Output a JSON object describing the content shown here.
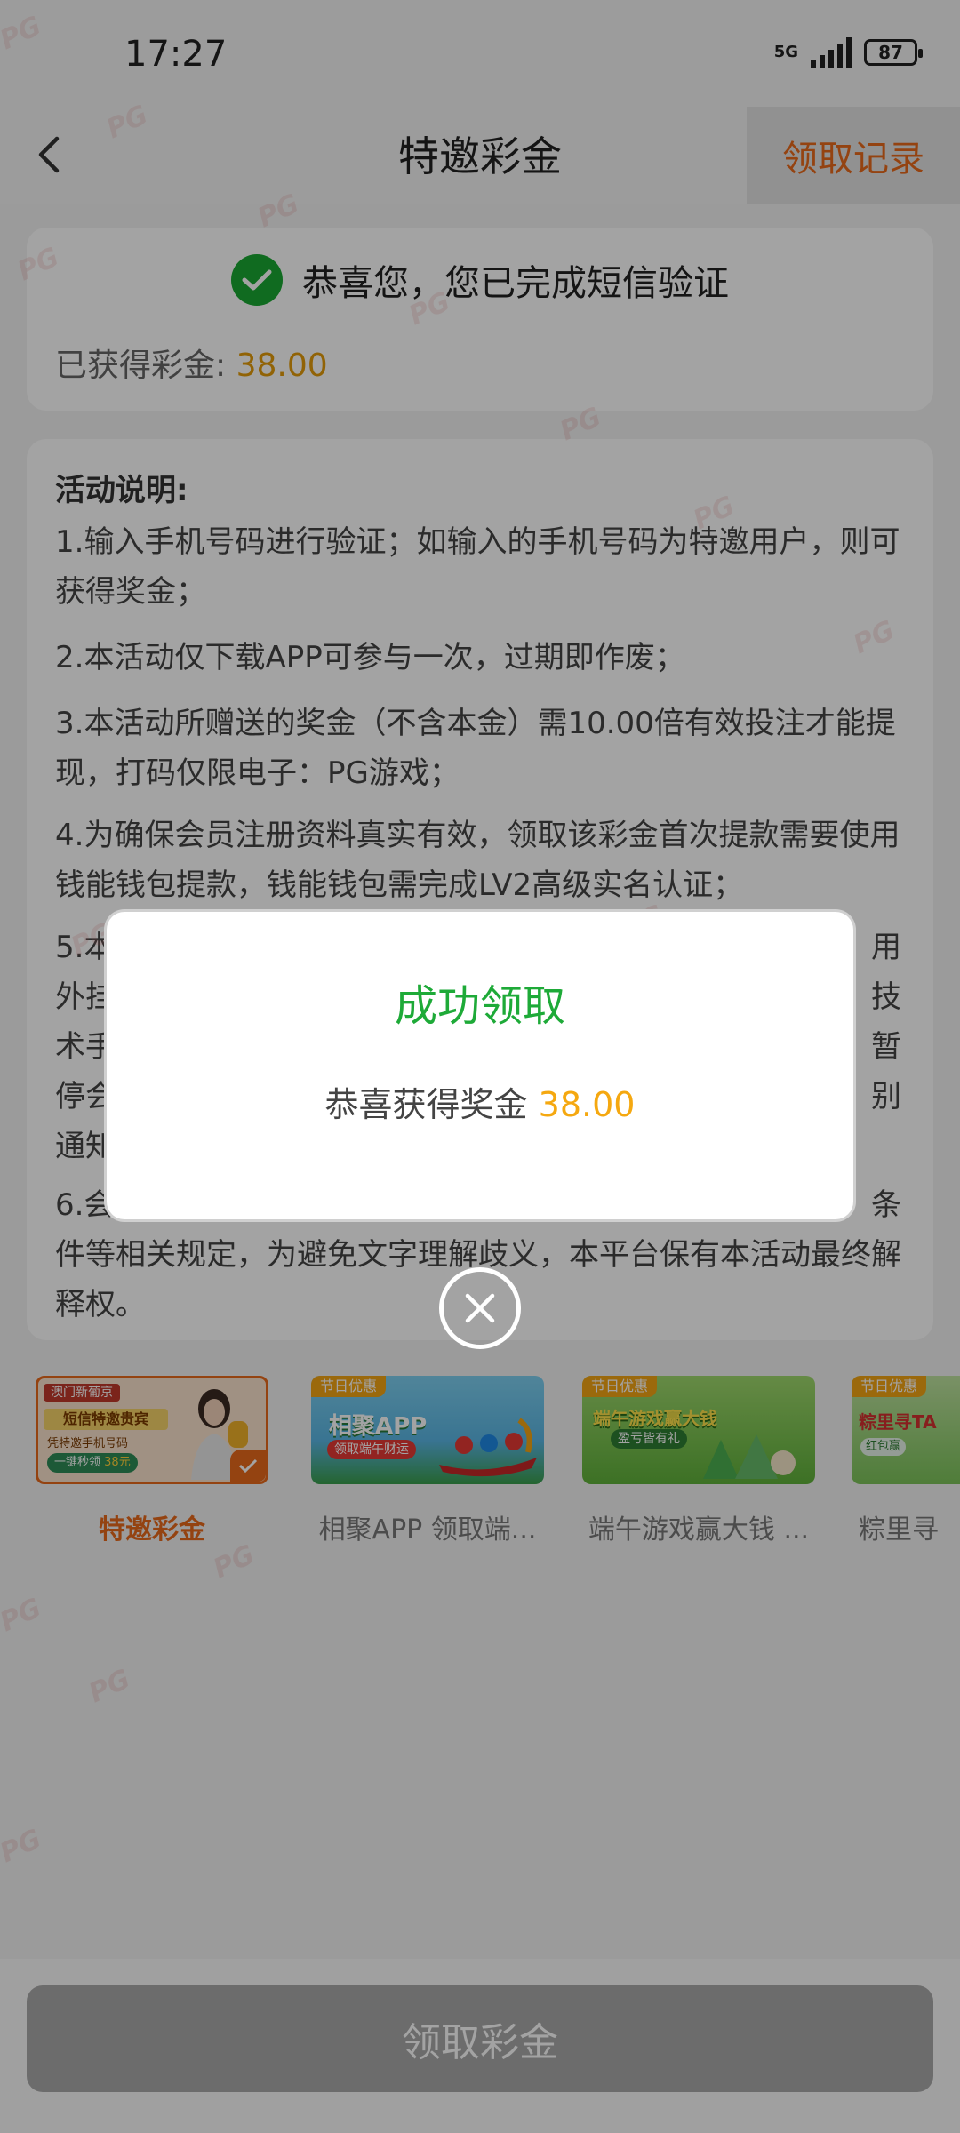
{
  "status": {
    "time": "17:27",
    "network": "5G",
    "battery": "87"
  },
  "header": {
    "title": "特邀彩金",
    "records_label": "领取记录"
  },
  "verify": {
    "message": "恭喜您，您已完成短信验证",
    "earned_label": "已获得彩金: ",
    "earned_amount": "38.00"
  },
  "rules": {
    "title": "活动说明:",
    "items": [
      "1.输入手机号码进行验证；如输入的手机号码为特邀用户，则可获得奖金；",
      "2.本活动仅下载APP可参与一次，过期即作废；",
      "3.本活动所赠送的奖金（不含本金）需10.00倍有效投注才能提现，打码仅限电子：PG游戏；",
      "4.为确保会员注册资料真实有效，领取该彩金首次提款需要使用钱能钱包提款，钱能钱包需完成LV2高级实名认证；",
      "5.本",
      "6.会",
      "件等相关规定，为避免文字理解歧义，本平台保有本活动最终解释权。"
    ],
    "rule5_right": [
      "用",
      "技",
      "暂",
      "别"
    ],
    "rule5_left": [
      "外挂",
      "术手",
      "停会",
      "通知"
    ],
    "rule6_right": "条"
  },
  "promos": [
    {
      "label": "特邀彩金",
      "banner_text": "短信特邀贵宾",
      "banner_sub": "凭特邀手机号码",
      "banner_btn": "一键秒领",
      "banner_amt": "38元",
      "brand": "澳门新葡京",
      "active": true
    },
    {
      "label": "相聚APP  领取端...",
      "tag": "节日优惠",
      "banner_text": "相聚APP",
      "banner_sub": "领取端午财运"
    },
    {
      "label": "端午游戏赢大钱  ...",
      "tag": "节日优惠",
      "banner_text": "端午游戏赢大钱",
      "banner_sub": "盈亏皆有礼"
    },
    {
      "label": "粽里寻",
      "tag": "节日优惠",
      "banner_text": "粽里寻TA",
      "banner_sub": "红包赢"
    }
  ],
  "claim_button": "领取彩金",
  "modal": {
    "title": "成功领取",
    "body": "恭喜获得奖金 ",
    "amount": "38.00"
  },
  "watermark": "PG",
  "colors": {
    "accent_orange": "#e8691b",
    "amount_gold": "#f5a810",
    "success_green": "#1eaa38"
  }
}
